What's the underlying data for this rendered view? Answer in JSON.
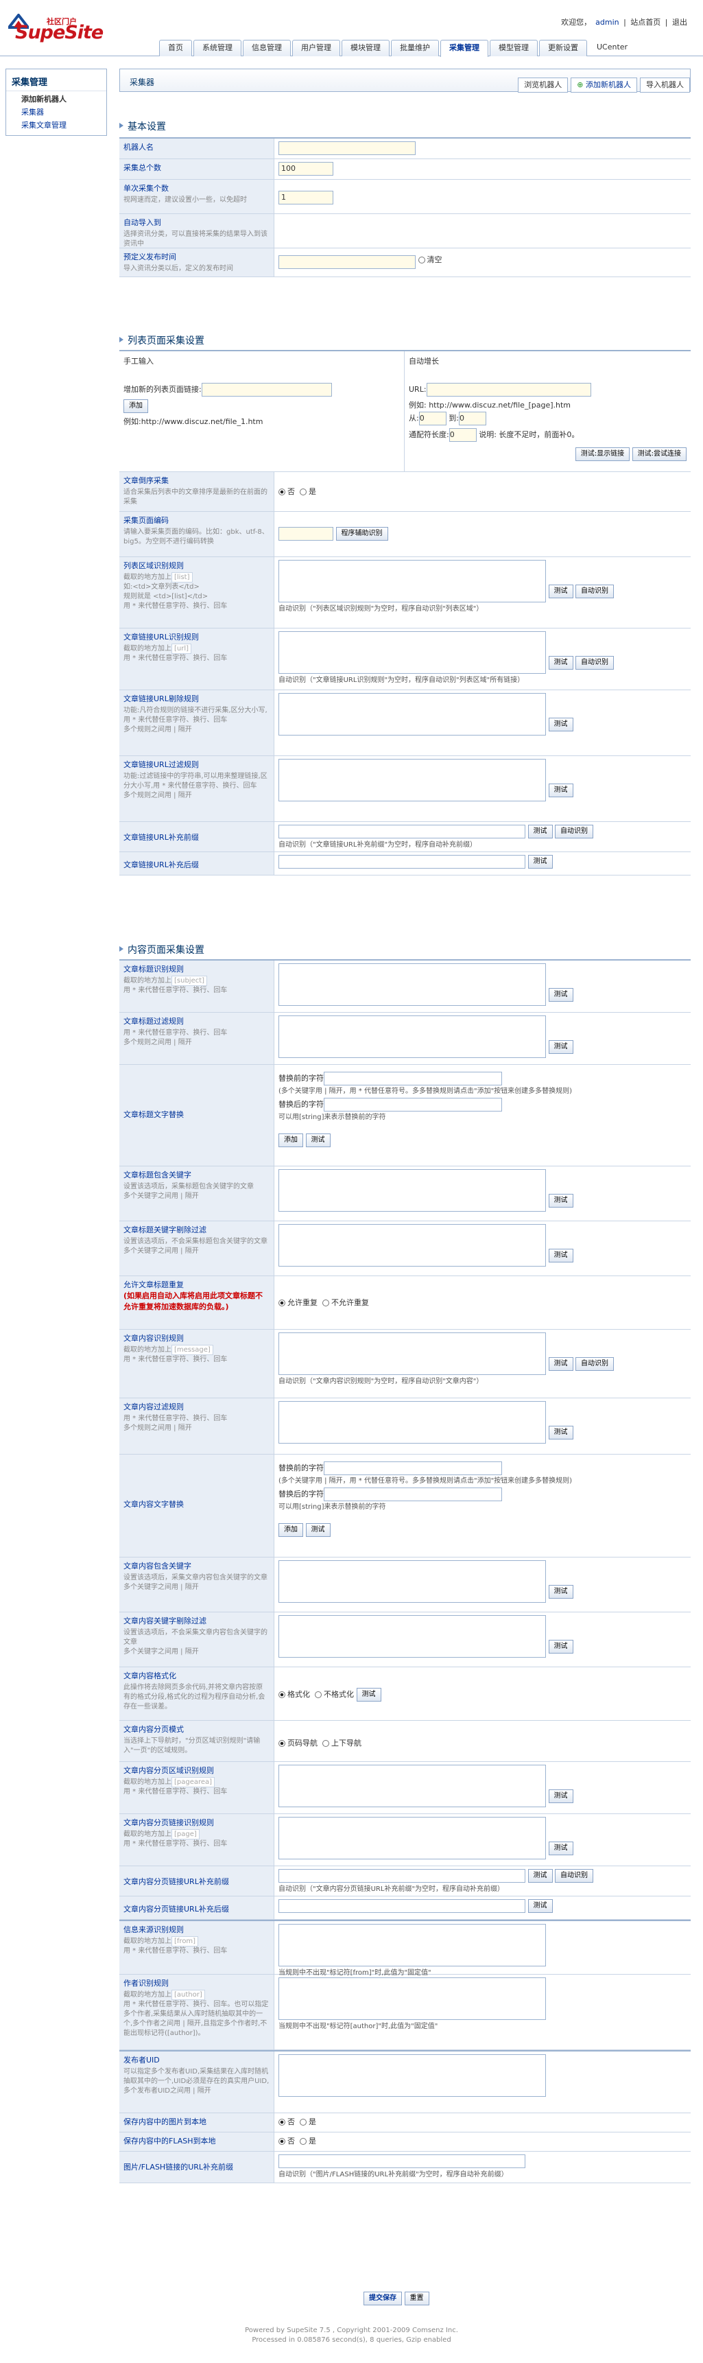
{
  "header": {
    "logo_sub": "社区门户",
    "logo_brand": "SupeSite",
    "welcome": "欢迎您，",
    "user": "admin",
    "links": [
      "站点首页",
      "退出"
    ]
  },
  "nav": [
    "首页",
    "系统管理",
    "信息管理",
    "用户管理",
    "模块管理",
    "批量维护",
    "采集管理",
    "模型管理",
    "更新设置",
    "UCenter"
  ],
  "side": {
    "title": "采集管理",
    "items": [
      "添加新机器人",
      "采集器",
      "采集文章管理"
    ]
  },
  "main": {
    "title": "采集器",
    "btn_browse": "浏览机器人",
    "btn_add": "添加新机器人",
    "btn_import": "导入机器人"
  },
  "sec1": {
    "title": "基本设置",
    "name": "机器人名",
    "total": "采集总个数",
    "total_val": "100",
    "per": "单次采集个数",
    "per_d": "视网速而定，建议设置小一些，以免超时",
    "per_val": "1",
    "auto": "自动导入到",
    "auto_d": "选择资讯分类，可以直接将采集的结果导入到该资讯中",
    "prev": "预定义发布时间",
    "prev_d": "导入资讯分类以后，定义的发布时间",
    "clear": "清空"
  },
  "sec2": {
    "title": "列表页面采集设置",
    "manual": "手工输入",
    "auto": "自动增长",
    "add_label": "增加新的列表页面链接:",
    "add_btn": "添加",
    "example1": "例如:http://www.discuz.net/file_1.htm",
    "url": "URL:",
    "example2": "例如: http://www.discuz.net/file_[page].htm",
    "from": "从:",
    "from_v": "0",
    "to": "到:",
    "to_v": "0",
    "wild": "通配符长度:",
    "wild_v": "0",
    "wild_d": "说明: 长度不足时，前面补0。",
    "b_show": "测试:显示链接",
    "b_try": "测试:尝试连接",
    "r1": "文章倒序采集",
    "r1_d": "适合采集后列表中的文章排序是最新的在前面的采集",
    "yes": "否",
    "no": "是",
    "r2": "采集页面编码",
    "r2_d": "请输入要采集页面的编码。比如：gbk、utf-8、big5。为空则不进行编码转换",
    "r2_btn": "程序辅助识别",
    "r3": "列表区域识别规则",
    "r3_d": "截取的地方加上",
    "r3_d2": "如:<td>文章列表</td>\n规则就是 <td>[list]</td>\n用 * 来代替任意字符、换行、回车",
    "r3_ph": "[list]",
    "r3_note": "自动识别（\"列表区域识别规则\"为空时，程序自动识别\"列表区域\"）",
    "r4": "文章链接URL识别规则",
    "r4_d": "截取的地方加上",
    "r4_ph": "[url]",
    "r4_d2": "用 * 来代替任意字符、换行、回车",
    "r4_note": "自动识别（\"文章链接URL识别规则\"为空时，程序自动识别\"列表区域\"所有链接）",
    "r5": "文章链接URL剔除规则",
    "r5_d": "功能:凡符合规则的链接不进行采集,区分大小写,用 * 来代替任意字符、换行、回车\n多个规则之间用 | 隔开",
    "r6": "文章链接URL过滤规则",
    "r6_d": "功能:过滤链接中的字符串,可以用来整理链接,区分大小写,用 * 来代替任意字符、换行、回车\n多个规则之间用 | 隔开",
    "r7": "文章链接URL补充前缀",
    "r7_note": "自动识别（\"文章链接URL补充前缀\"为空时，程序自动补充前缀）",
    "r8": "文章链接URL补充后缀"
  },
  "sec3": {
    "title": "内容页面采集设置",
    "c1": "文章标题识别规则",
    "c1_ph": "[subject]",
    "c2": "文章标题过滤规则",
    "c3": "文章标题文字替换",
    "rep1": "替换前的字符",
    "rep_d": "(多个关键字用 | 隔开，用 * 代替任意符号。多多替换规则请点击\"添加\"按钮来创建多多替换规则)",
    "rep2": "替换后的字符",
    "rep_d2": "可以用[string]来表示替换前的字符",
    "add": "添加",
    "test": "测试",
    "auto_btn": "自动识别",
    "c4": "文章标题包含关键字",
    "c4_d": "设置该选项后，采集标题包含关键字的文章\n多个关键字之间用 | 隔开",
    "c5": "文章标题关键字剔除过滤",
    "c5_d": "设置该选项后，不会采集标题包含关键字的文章\n多个关键字之间用 | 隔开",
    "c6": "允许文章标题重复",
    "c6_d": "(如果启用自动入库将启用此项文章标题不允许重复将加速数据库的负载。)",
    "allow": "允许重复",
    "deny": "不允许重复",
    "c7": "文章内容识别规则",
    "c7_ph": "[message]",
    "c7_note": "自动识别（\"文章内容识别规则\"为空时，程序自动识别\"文章内容\"）",
    "c8": "文章内容过滤规则",
    "c9": "文章内容文字替换",
    "c10": "文章内容包含关键字",
    "c10_d": "设置该选项后，采集文章内容包含关键字的文章\n多个关键字之间用 | 隔开",
    "c11": "文章内容关键字剔除过滤",
    "c11_d": "设置该选项后，不会采集文章内容包含关键字的文章\n多个关键字之间用 | 隔开",
    "c12": "文章内容格式化",
    "c12_d": "此操作将去除网页多余代码,并将文章内容按原有的格式分段,格式化的过程为程序自动分析,会存在一些误差。",
    "fmt": "格式化",
    "nofmt": "不格式化",
    "c13": "文章内容分页模式",
    "c13_d": "当选择上下导航时，\"分页区域识别规则\"请输入\"一页\"的区域规则。",
    "p1": "页码导航",
    "p2": "上下导航",
    "c14": "文章内容分页区域识别规则",
    "c14_ph": "[pagearea]",
    "c15": "文章内容分页链接识别规则",
    "c15_ph": "[page]",
    "c16": "文章内容分页链接URL补充前缀",
    "c16_note": "自动识别（\"文章内容分页链接URL补充前缀\"为空时，程序自动补充前缀）",
    "c17": "文章内容分页链接URL补充后缀",
    "c18": "信息来源识别规则",
    "c18_ph": "[from]",
    "c18_note": "当规则中不出现\"标记符[from]\"时,此值为\"固定值\"",
    "c19": "作者识别规则",
    "c19_ph": "[author]",
    "c19_d": "用 * 来代替任意字符、换行、回车。也可以指定多个作者,采集结果从入库时随机抽取其中的一个,多个作者之间用 | 隔开,且指定多个作者时,不能出现标记符([author])。",
    "c19_note": "当规则中不出现\"标记符[author]\"时,此值为\"固定值\"",
    "c20": "发布者UID",
    "c20_d": "可以指定多个发布者UID,采集结果在入库时随机抽取其中的一个,UID必须是存在的真实用户UID,多个发布者UID之间用 | 隔开",
    "c21": "保存内容中的图片到本地",
    "c22": "保存内容中的FLASH到本地",
    "c23": "图片/FLASH链接的URL补充前缀",
    "c23_note": "自动识别（\"图片/FLASH链接的URL补充前缀\"为空时，程序自动补充前缀）",
    "rule_d": "截取的地方加上",
    "any": "用 * 来代替任意字符、换行、回车",
    "multi": "用 * 来代替任意字符、换行、回车\n多个规则之间用 | 隔开"
  },
  "submit": {
    "save": "提交保存",
    "reset": "重置"
  },
  "footer": [
    "Powered by SupeSite 7.5 , Copyright 2001-2009 Comsenz Inc.",
    "Processed in 0.085876 second(s), 8 queries, Gzip enabled"
  ]
}
